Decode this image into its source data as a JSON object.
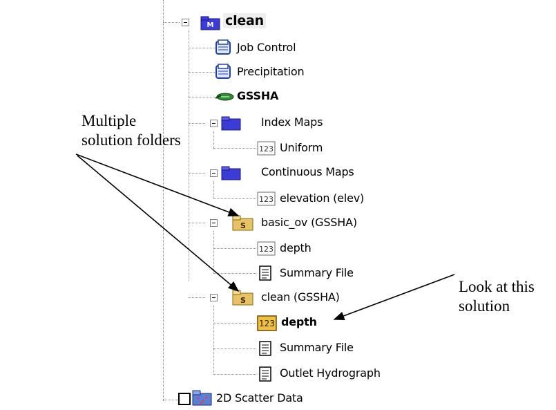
{
  "tree": {
    "root_label": "clean",
    "root_badge": "M",
    "items": [
      {
        "label": "Job Control",
        "icon": "file-icon"
      },
      {
        "label": "Precipitation",
        "icon": "file-icon"
      },
      {
        "label": "GSSHA",
        "icon": "gssha-model-icon"
      },
      {
        "label": "Index Maps",
        "icon": "folder-icon"
      },
      {
        "label": "Uniform",
        "icon": "dataset-123-icon"
      },
      {
        "label": "Continuous Maps",
        "icon": "folder-icon"
      },
      {
        "label": "elevation (elev)",
        "icon": "dataset-123-icon"
      },
      {
        "label": "basic_ov (GSSHA)",
        "icon": "solution-folder-icon"
      },
      {
        "label": "depth",
        "icon": "dataset-123-icon"
      },
      {
        "label": "Summary File",
        "icon": "text-file-icon"
      },
      {
        "label": "clean (GSSHA)",
        "icon": "solution-folder-icon"
      },
      {
        "label": "depth",
        "icon": "dataset-123-icon"
      },
      {
        "label": "Summary File",
        "icon": "text-file-icon"
      },
      {
        "label": "Outlet Hydrograph",
        "icon": "text-file-icon"
      },
      {
        "label": "2D Scatter Data",
        "icon": "scatter-folder-icon"
      }
    ],
    "dataset_glyph": "123",
    "solution_badge": "S"
  },
  "annotations": {
    "multiple_solutions": [
      "Multiple",
      "solution folders"
    ],
    "look_at": [
      "Look at this",
      "solution"
    ]
  },
  "colors": {
    "folder": "#3b3bd6",
    "solution_folder": "#e8c266",
    "selected_dataset": "#f0c040",
    "model_green": "#2e8b2e"
  }
}
